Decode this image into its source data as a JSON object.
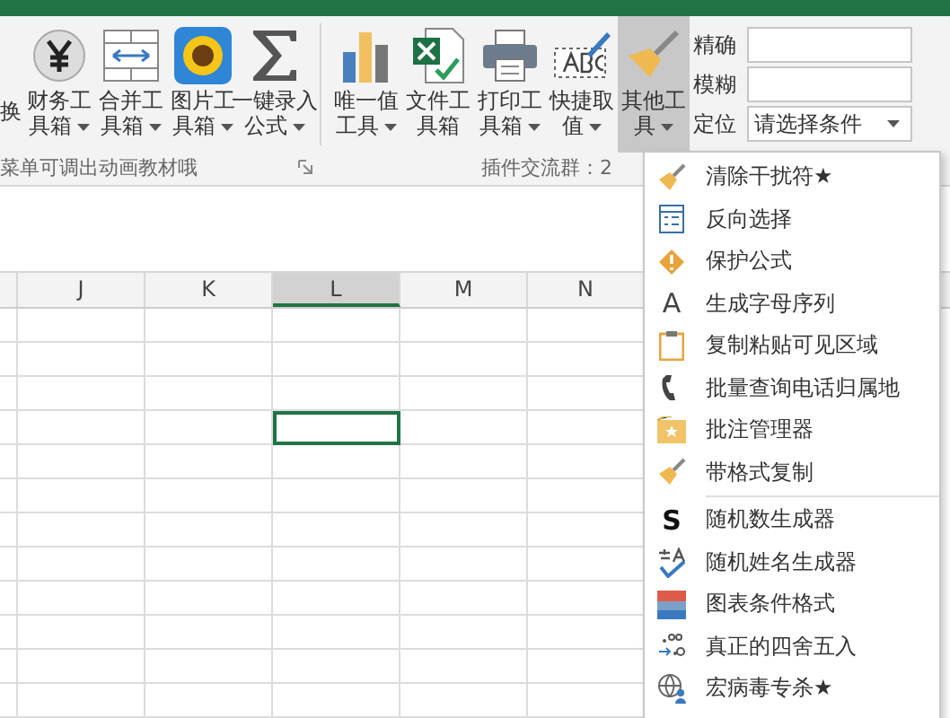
{
  "ribbon": {
    "buttons": [
      {
        "kind": "partial",
        "line1": "换"
      },
      {
        "kind": "yen",
        "line1": "财务工",
        "line2": "具箱",
        "has_menu": true,
        "highlighted": false
      },
      {
        "kind": "merge",
        "line1": "合并工",
        "line2": "具箱",
        "has_menu": true,
        "highlighted": false
      },
      {
        "kind": "sunflower",
        "line1": "图片工",
        "line2": "具箱",
        "has_menu": true,
        "highlighted": false
      },
      {
        "kind": "sigma",
        "line1": "一键录入",
        "line2": "公式",
        "has_menu": true,
        "highlighted": false
      },
      {
        "kind": "separator"
      },
      {
        "kind": "bars",
        "line1": "唯一值",
        "line2": "工具",
        "has_menu": true,
        "highlighted": false
      },
      {
        "kind": "excel",
        "line1": "文件工",
        "line2": "具箱",
        "has_menu": false,
        "highlighted": false
      },
      {
        "kind": "printer",
        "line1": "打印工",
        "line2": "具箱",
        "has_menu": true,
        "highlighted": false
      },
      {
        "kind": "abc",
        "line1": "快捷取",
        "line2": "值",
        "has_menu": true,
        "highlighted": false
      },
      {
        "kind": "broom",
        "line1": "其他工",
        "line2": "具",
        "has_menu": true,
        "highlighted": true
      }
    ],
    "fields": [
      {
        "label": "精确",
        "kind": "text"
      },
      {
        "label": "模糊",
        "kind": "text"
      },
      {
        "label": "定位",
        "kind": "dropdown",
        "value": "请选择条件"
      }
    ],
    "group_labels": [
      "菜单可调出动画教材哦",
      "插件交流群：2"
    ]
  },
  "columns": [
    {
      "selected": false
    },
    {
      "label": "J",
      "selected": false
    },
    {
      "label": "K",
      "selected": false
    },
    {
      "label": "L",
      "selected": true
    },
    {
      "label": "M",
      "selected": false
    },
    {
      "label": "N",
      "selected": false
    }
  ],
  "rows": [
    {
      "selected": false
    },
    {
      "selected": false
    },
    {
      "selected": false
    },
    {
      "selected": true
    },
    {
      "selected": false
    },
    {
      "selected": false
    },
    {
      "selected": false
    },
    {
      "selected": false
    },
    {
      "selected": false
    },
    {
      "selected": false
    },
    {
      "selected": false
    },
    {
      "selected": false
    }
  ],
  "menu": [
    {
      "kind": "broom",
      "label": "清除干扰符★"
    },
    {
      "kind": "list",
      "label": "反向选择"
    },
    {
      "kind": "warning",
      "label": "保护公式"
    },
    {
      "kind": "letter",
      "icon_text": "A",
      "label": "生成字母序列"
    },
    {
      "kind": "clipboard",
      "label": "复制粘贴可见区域"
    },
    {
      "kind": "phone",
      "label": "批量查询电话归属地"
    },
    {
      "kind": "note",
      "label": "批注管理器"
    },
    {
      "kind": "broom",
      "label": "带格式复制",
      "separator_after": true
    },
    {
      "kind": "bold",
      "icon_text": "S",
      "label": "随机数生成器"
    },
    {
      "kind": "name",
      "label": "随机姓名生成器"
    },
    {
      "kind": "colorbars",
      "label": "图表条件格式"
    },
    {
      "kind": "round",
      "label": "真正的四舍五入"
    },
    {
      "kind": "globe",
      "label": "宏病毒专杀★"
    }
  ]
}
